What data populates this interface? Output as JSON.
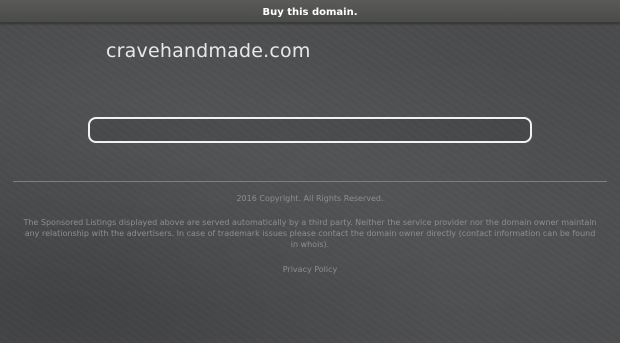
{
  "topbar": {
    "buy_label": "Buy this domain."
  },
  "header": {
    "domain": "cravehandmade.com"
  },
  "search": {
    "value": "",
    "placeholder": ""
  },
  "footer": {
    "copyright": "2016 Copyright. All Rights Reserved.",
    "disclaimer": "The Sponsored Listings displayed above are served automatically by a third party. Neither the service provider nor the domain owner maintain any relationship with the advertisers. In case of trademark issues please contact the domain owner directly (contact information can be found in whois).",
    "privacy_label": "Privacy Policy"
  },
  "colors": {
    "background": "#4a4b4d",
    "topbar": "#535352",
    "text_light": "#e8e8e8",
    "footer_text": "#8d8e8f"
  }
}
